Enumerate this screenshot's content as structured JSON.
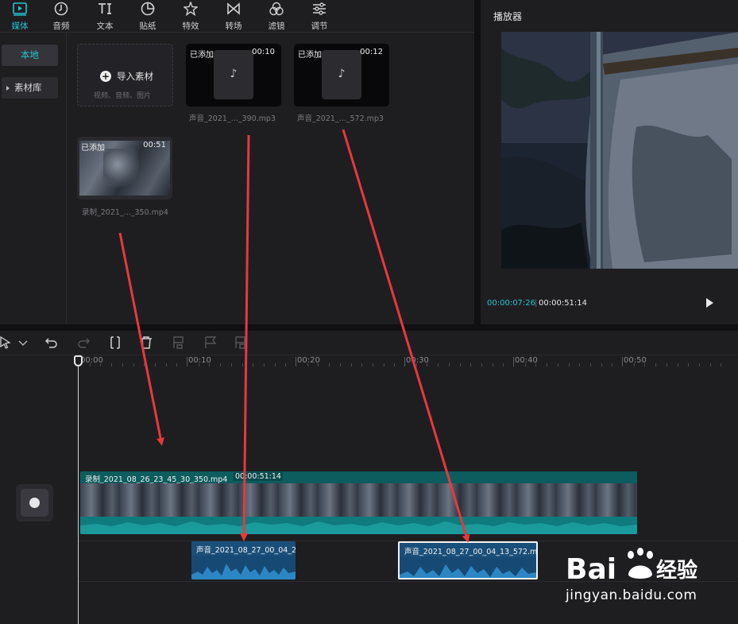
{
  "toolbar": {
    "tabs": [
      {
        "label": "媒体",
        "icon": "play-square-icon",
        "active": true
      },
      {
        "label": "音频",
        "icon": "music-clock-icon",
        "active": false
      },
      {
        "label": "文本",
        "icon": "text-ti-icon",
        "active": false
      },
      {
        "label": "贴纸",
        "icon": "sticker-icon",
        "active": false
      },
      {
        "label": "特效",
        "icon": "sparkle-star-icon",
        "active": false
      },
      {
        "label": "转场",
        "icon": "bowtie-icon",
        "active": false
      },
      {
        "label": "滤镜",
        "icon": "filter-circles-icon",
        "active": false
      },
      {
        "label": "调节",
        "icon": "sliders-icon",
        "active": false
      }
    ],
    "accent_color": "#27c3cf"
  },
  "sidebar": {
    "local_label": "本地",
    "library_label": "素材库"
  },
  "media": {
    "import_label": "导入素材",
    "import_hint": "视频、音频、图片",
    "items": [
      {
        "added": "已添加",
        "duration": "00:10",
        "name": "声音_2021_..._390.mp3",
        "kind": "audio"
      },
      {
        "added": "已添加",
        "duration": "00:12",
        "name": "声音_2021_..._572.mp3",
        "kind": "audio"
      },
      {
        "added": "已添加",
        "duration": "00:51",
        "name": "录制_2021_..._350.mp4",
        "kind": "video"
      }
    ]
  },
  "player": {
    "title": "播放器",
    "current_time": "00:00:07:26",
    "separator": "|",
    "total_time": "00:00:51:14"
  },
  "timeline": {
    "ticks": [
      "00:00",
      "00:10",
      "00:20",
      "00:30",
      "00:40",
      "00:50"
    ],
    "video_clip": {
      "name": "录制_2021_08_26_23_45_30_350.mp4",
      "duration": "00:00:51:14"
    },
    "audio_clips": [
      {
        "name": "声音_2021_08_27_00_04_28",
        "selected": false
      },
      {
        "name": "声音_2021_08_27_00_04_13_572.m",
        "selected": true
      }
    ]
  },
  "watermark": {
    "brand": "Bai",
    "brand_suffix": "经验",
    "url": "jingyan.baidu.com"
  }
}
